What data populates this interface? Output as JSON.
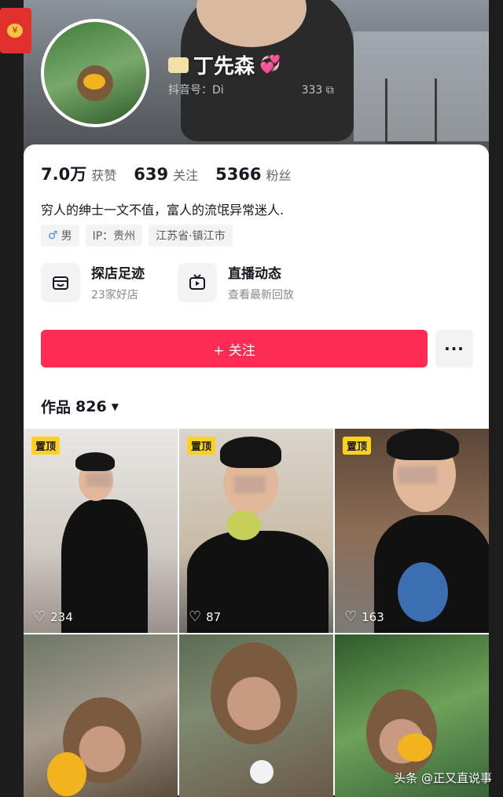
{
  "profile": {
    "name": "丁先森",
    "account_prefix": "抖音号：",
    "account_id_partial": "Di",
    "account_id_tail": "333"
  },
  "stats": [
    {
      "num": "7.0万",
      "label": "获赞"
    },
    {
      "num": "639",
      "label": "关注"
    },
    {
      "num": "5366",
      "label": "粉丝"
    }
  ],
  "bio": "穷人的绅士一文不值，富人的流氓异常迷人.",
  "tags": {
    "gender": "男",
    "ip": "IP：贵州",
    "location": "江苏省·镇江市"
  },
  "features": [
    {
      "title": "探店足迹",
      "sub": "23家好店",
      "icon": "shop-icon"
    },
    {
      "title": "直播动态",
      "sub": "查看最新回放",
      "icon": "tv-icon"
    }
  ],
  "actions": {
    "follow_label": "+ 关注",
    "more_label": "···"
  },
  "works": {
    "label": "作品",
    "count": "826"
  },
  "videos": [
    {
      "pinned": "置顶",
      "likes": "234"
    },
    {
      "pinned": "置顶",
      "likes": "87"
    },
    {
      "pinned": "置顶",
      "likes": "163"
    },
    {
      "pinned": "",
      "likes": ""
    },
    {
      "pinned": "",
      "likes": ""
    },
    {
      "pinned": "",
      "likes": ""
    }
  ],
  "watermark": "头条 @正又直说事",
  "colors": {
    "accent": "#fe2c55",
    "pin": "#fcd21e",
    "text": "#161823"
  }
}
